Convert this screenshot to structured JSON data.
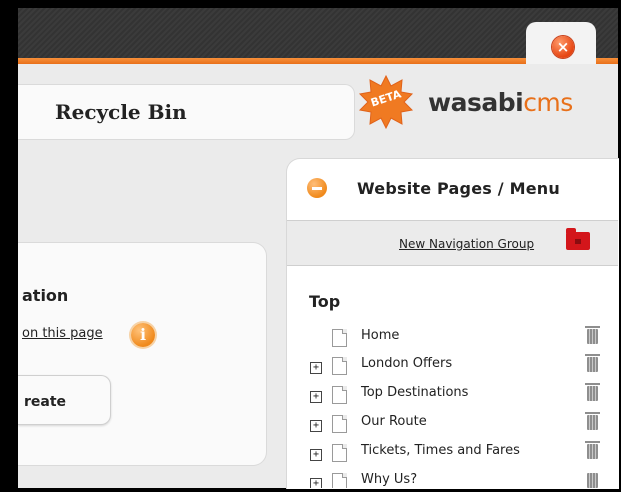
{
  "header": {
    "title": "Recycle Bin",
    "logo_badge": "BETA",
    "logo_word": "wasabi",
    "logo_suffix": "cms",
    "close_glyph": "×"
  },
  "left": {
    "section_heading": "ation",
    "help_link": "on this page",
    "info_glyph": "i",
    "create_label": "reate"
  },
  "panel": {
    "title": "Website Pages / Menu",
    "new_nav_group": "New Navigation Group",
    "group_heading": "Top",
    "pages": [
      {
        "label": "Home",
        "expandable": false
      },
      {
        "label": "London Offers",
        "expandable": true
      },
      {
        "label": "Top Destinations",
        "expandable": true
      },
      {
        "label": "Our Route",
        "expandable": true
      },
      {
        "label": "Tickets, Times and Fares",
        "expandable": true
      },
      {
        "label": "Why Us?",
        "expandable": true
      }
    ]
  },
  "icons": {
    "close": "close-icon",
    "info": "info-icon",
    "collapse": "collapse-icon",
    "folder": "red-folder-icon",
    "page": "page-icon",
    "expand": "plus-square-icon",
    "delete": "trash-icon"
  },
  "colors": {
    "accent_orange": "#e8701a",
    "folder_red": "#d3161b",
    "header_dark": "#3a3a3a"
  }
}
